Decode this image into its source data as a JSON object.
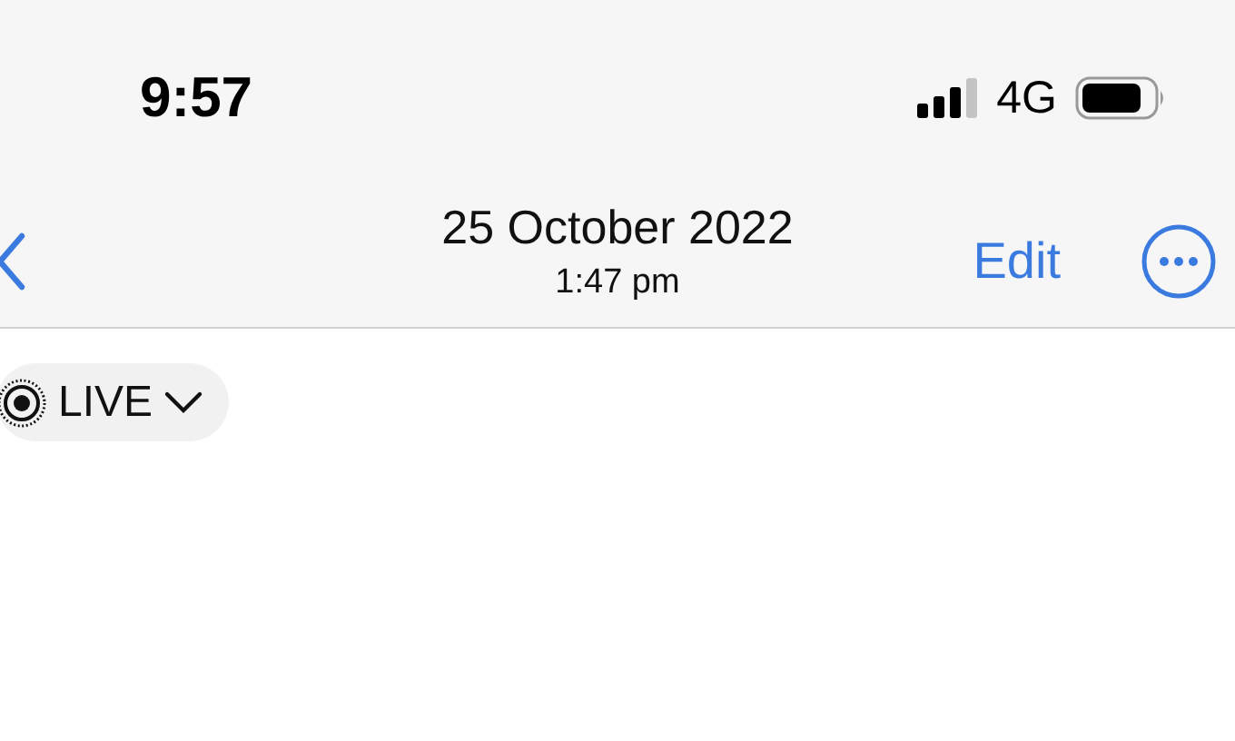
{
  "status_bar": {
    "time": "9:57",
    "network": "4G"
  },
  "nav_bar": {
    "title": "25 October 2022",
    "subtitle": "1:47 pm",
    "edit": "Edit"
  },
  "live_button": {
    "label": "LIVE"
  }
}
